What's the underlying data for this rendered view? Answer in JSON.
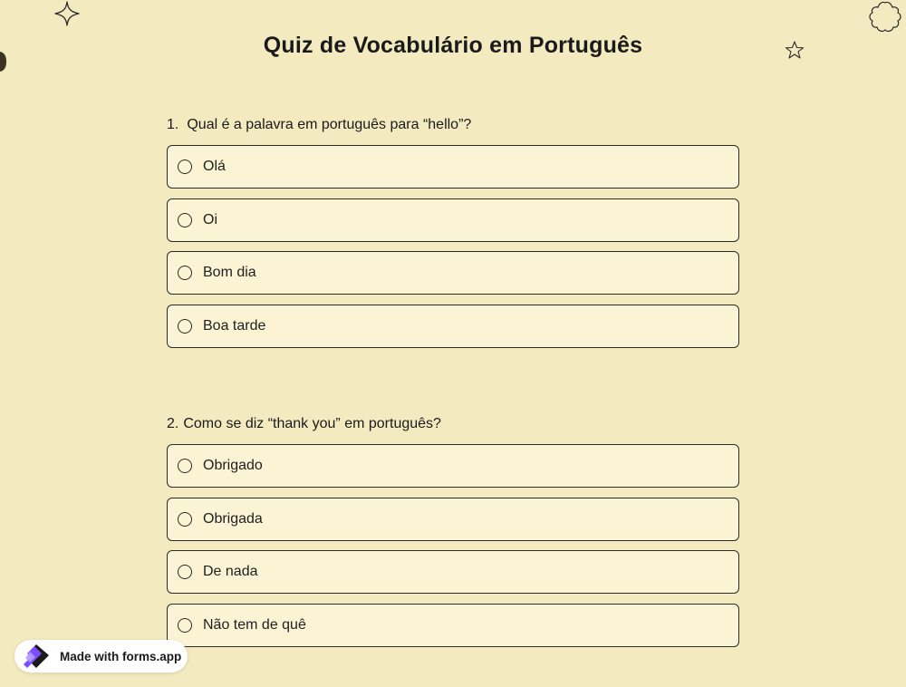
{
  "page": {
    "title": "Quiz de Vocabulário em Português"
  },
  "questions": [
    {
      "number": "1.",
      "text": "Qual é a palavra em português para “hello”?",
      "options": [
        "Olá",
        "Oi",
        "Bom dia",
        "Boa tarde"
      ]
    },
    {
      "number": "2.",
      "text": "Como se diz “thank you” em português?",
      "options": [
        "Obrigado",
        "Obrigada",
        "De nada",
        "Não tem de quê"
      ]
    }
  ],
  "badge": {
    "label": "Made with forms.app",
    "logo_icon": "forms-app-logo-icon",
    "logo_colors": [
      "#7b4dff",
      "#1a1a1a"
    ]
  },
  "decorations": [
    "sparkle-star-icon",
    "flower-outline-icon",
    "small-star-icon",
    "moon-icon"
  ],
  "colors": {
    "background": "#f4eac0",
    "option_background": "#faf3d4",
    "border": "#2b2b2b",
    "text": "#1a1a1a"
  }
}
